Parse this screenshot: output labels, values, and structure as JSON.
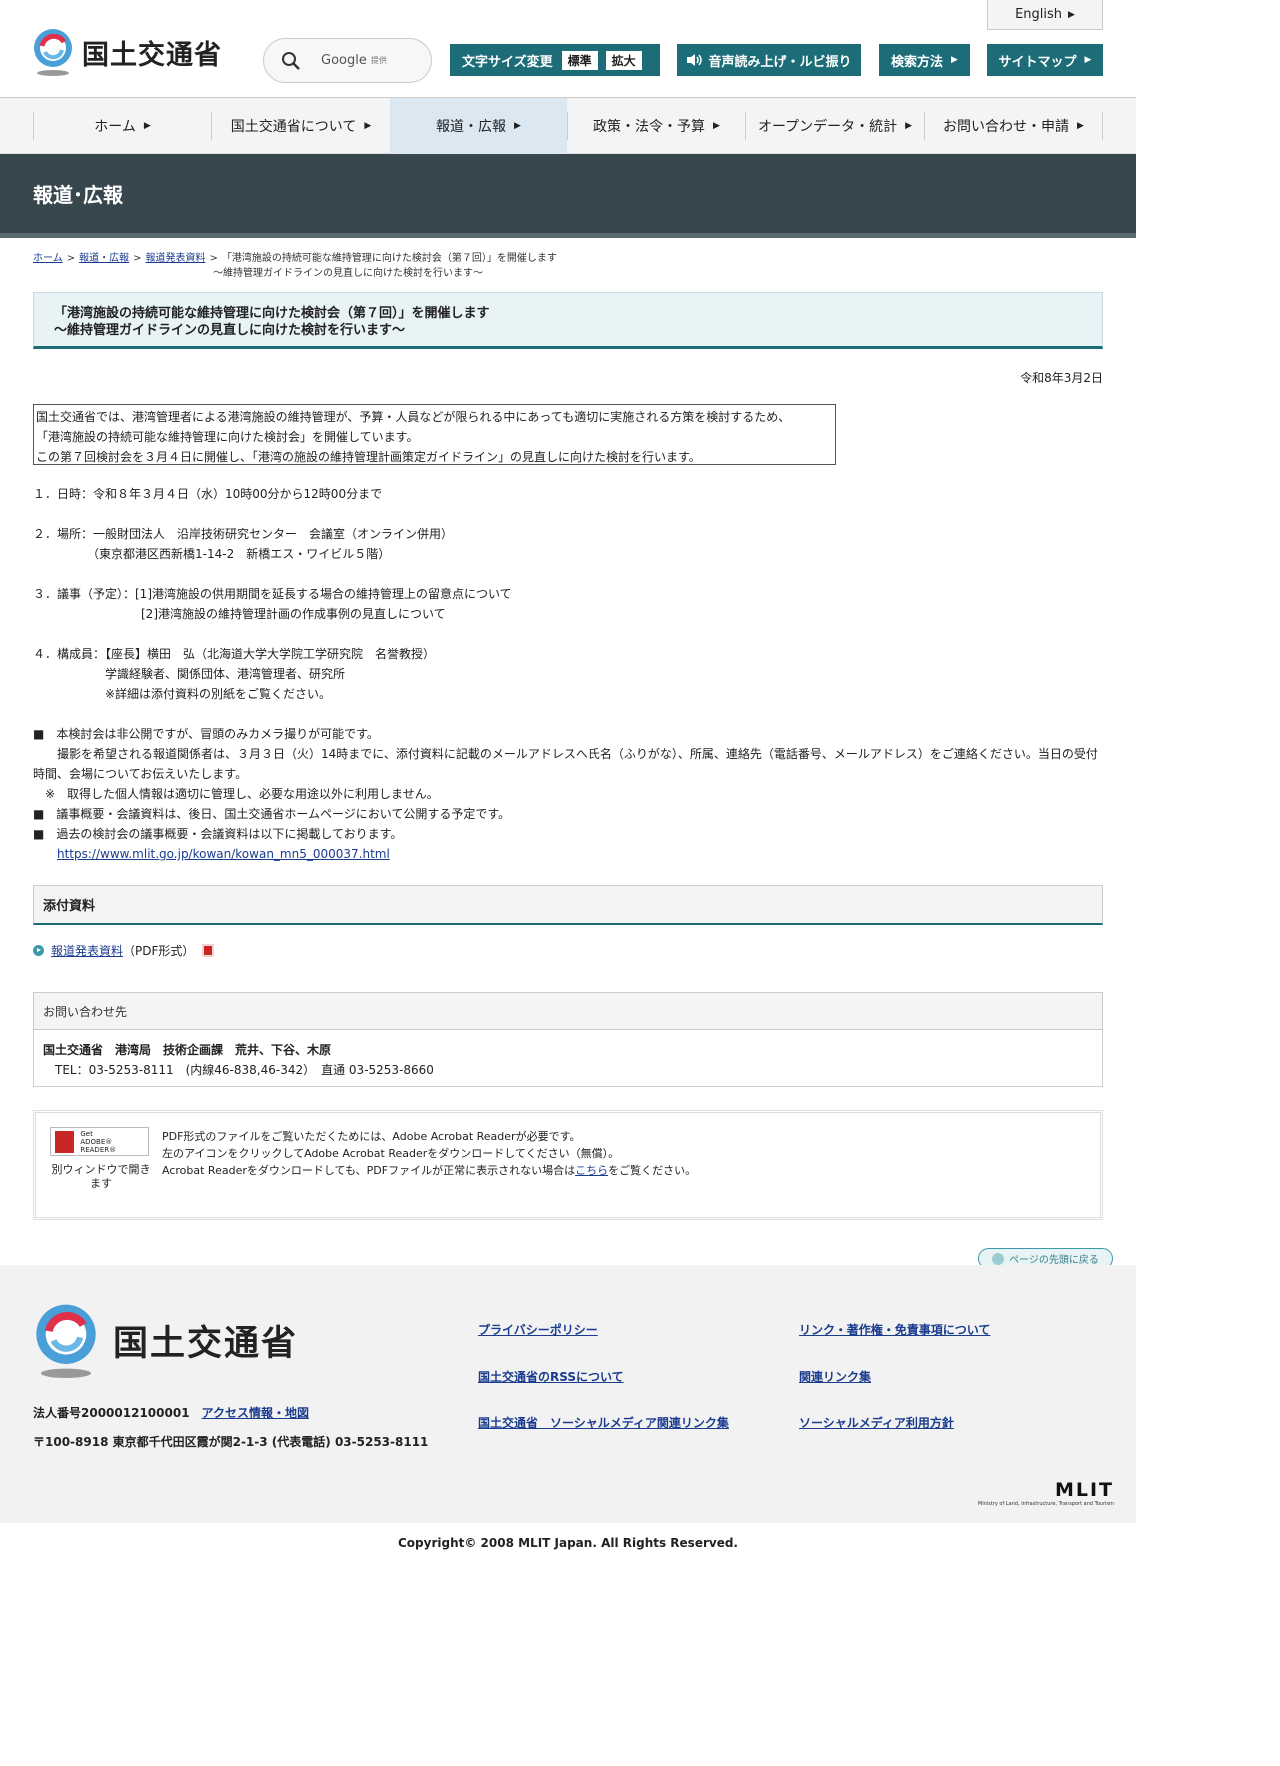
{
  "header": {
    "lang_label": "English",
    "logo_text": "国土交通省",
    "search_brand": "Google",
    "search_sub": "提供",
    "font_size_label": "文字サイズ変更",
    "font_standard": "標準",
    "font_large": "拡大",
    "voice_label": "音声読み上げ・ルビ振り",
    "search_method_label": "検索方法",
    "sitemap_label": "サイトマップ",
    "accent_color": "#1c6d78"
  },
  "nav": {
    "items": [
      {
        "label": "ホーム"
      },
      {
        "label": "国土交通省について"
      },
      {
        "label": "報道・広報"
      },
      {
        "label": "政策・法令・予算"
      },
      {
        "label": "オープンデータ・統計"
      },
      {
        "label": "お問い合わせ・申請"
      }
    ],
    "active_index": 2
  },
  "page_band_title": "報道･広報",
  "breadcrumb": {
    "home": "ホーム",
    "press": "報道・広報",
    "releases": "報道発表資料",
    "current_line1": "「港湾施設の持続可能な維持管理に向けた検討会（第７回）」を開催します",
    "current_line2": "～維持管理ガイドラインの見直しに向けた検討を行います～"
  },
  "article": {
    "title_line1": "「港湾施設の持続可能な維持管理に向けた検討会（第７回）」を開催します",
    "title_line2": "～維持管理ガイドラインの見直しに向けた検討を行います～",
    "date": "令和8年3月2日",
    "lead": [
      "国土交通省では、港湾管理者による港湾施設の維持管理が、予算・人員などが限られる中にあっても適切に実施される方策を検討するため、",
      "「港湾施設の持続可能な維持管理に向けた検討会」を開催しています。",
      "この第７回検討会を３月４日に開催し、「港湾の施設の維持管理計画策定ガイドライン」の見直しに向けた検討を行います。"
    ],
    "item1": "１．日時：令和８年３月４日（水）10時00分から12時00分まで",
    "item2_line1": "２．場所：一般財団法人　沿岸技術研究センター　会議室（オンライン併用）",
    "item2_line2": "　　　　　（東京都港区西新橋1-14-2　新橋エス・ワイビル５階）",
    "item3_line1": "３．議事（予定）：[1]港湾施設の供用期間を延長する場合の維持管理上の留意点について",
    "item3_line2": "　　　　　　　　　[2]港湾施設の維持管理計画の作成事例の見直しについて",
    "item4_line1": "４．構成員：【座長】横田　弘（北海道大学大学院工学研究院　名誉教授）",
    "item4_line2": "　　　　　　学識経験者、関係団体、港湾管理者、研究所",
    "item4_line3": "　　　　　　※詳細は添付資料の別紙をご覧ください。",
    "note1": "■　本検討会は非公開ですが、冒頭のみカメラ撮りが可能です。",
    "note1_detail": "　　撮影を希望される報道関係者は、３月３日（火）14時までに、添付資料に記載のメールアドレスへ氏名（ふりがな）、所属、連絡先（電話番号、メールアドレス）をご連絡ください。当日の受付時間、会場についてお伝えいたします。",
    "note1_privacy": "　※　取得した個人情報は適切に管理し、必要な用途以外に利用しません。",
    "note2": "■　議事概要・会議資料は、後日、国土交通省ホームページにおいて公開する予定です。",
    "note3": "■　過去の検討会の議事概要・会議資料は以下に掲載しております。",
    "past_url": "https://www.mlit.go.jp/kowan/kowan_mn5_000037.html"
  },
  "attachments": {
    "heading": "添付資料",
    "link_label": "報道発表資料",
    "format": "（PDF形式）"
  },
  "contact": {
    "heading": "お問い合わせ先",
    "org": "国土交通省　港湾局　技術企画課　荒井、下谷、木原",
    "tel": "TEL：03-5253-8111　(内線46-838,46-342）　直通 03-5253-8660"
  },
  "reader": {
    "badge_get": "Get",
    "badge_name": "ADOBE® READER®",
    "new_window": "別ウィンドウで開きます",
    "line1": "PDF形式のファイルをご覧いただくためには、Adobe Acrobat Readerが必要です。",
    "line2": "左のアイコンをクリックしてAdobe Acrobat Readerをダウンロードしてください（無償）。",
    "line3_pre": "Acrobat Readerをダウンロードしても、PDFファイルが正常に表示されない場合は",
    "line3_link": "こちら",
    "line3_post": "をご覧ください。"
  },
  "back_to_top": "ページの先頭に戻る",
  "footer": {
    "logo_text": "国土交通省",
    "corp_number": "法人番号2000012100001",
    "access": "アクセス情報・地図",
    "address": "〒100-8918 東京都千代田区霞が関2-1-3 (代表電話) 03-5253-8111",
    "links": [
      "プライバシーポリシー",
      "リンク・著作権・免責事項について",
      "国土交通省のRSSについて",
      "関連リンク集",
      "国土交通省　ソーシャルメディア関連リンク集",
      "ソーシャルメディア利用方針"
    ],
    "mlit": "MLIT",
    "mlit_full": "Ministry of Land, Infrastructure, Transport and Tourism",
    "copyright": "Copyright© 2008 MLIT Japan. All Rights Reserved."
  }
}
